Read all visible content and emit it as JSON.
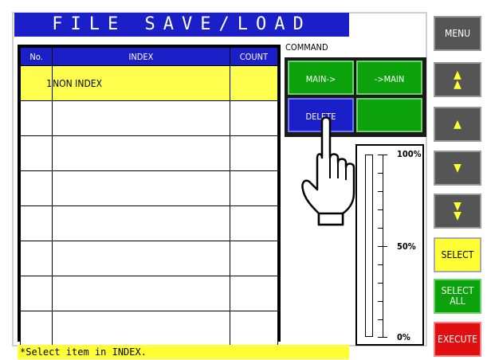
{
  "title": "FILE SAVE/LOAD",
  "table": {
    "headers": [
      "No.",
      "INDEX",
      "COUNT"
    ],
    "rows": [
      {
        "no": "1",
        "index": "NON INDEX",
        "count": ""
      },
      {
        "no": "",
        "index": "",
        "count": ""
      },
      {
        "no": "",
        "index": "",
        "count": ""
      },
      {
        "no": "",
        "index": "",
        "count": ""
      },
      {
        "no": "",
        "index": "",
        "count": ""
      },
      {
        "no": "",
        "index": "",
        "count": ""
      },
      {
        "no": "",
        "index": "",
        "count": ""
      },
      {
        "no": "",
        "index": "",
        "count": ""
      }
    ]
  },
  "command": {
    "label": "COMMAND",
    "main_to": "MAIN->",
    "to_main": "->MAIN",
    "delete": "DELETE"
  },
  "gauge": {
    "top": "100%",
    "mid": "50%",
    "bottom": "0%",
    "fill_fraction": 0
  },
  "status": "*Select item in INDEX.",
  "side": {
    "menu": "MENU",
    "select": "SELECT",
    "select_all_1": "SELECT",
    "select_all_2": "ALL",
    "execute": "EXECUTE"
  },
  "colors": {
    "blue": "#1a1fc8",
    "green": "#0ca20c",
    "yellow": "#ffff33",
    "red": "#e01010"
  }
}
